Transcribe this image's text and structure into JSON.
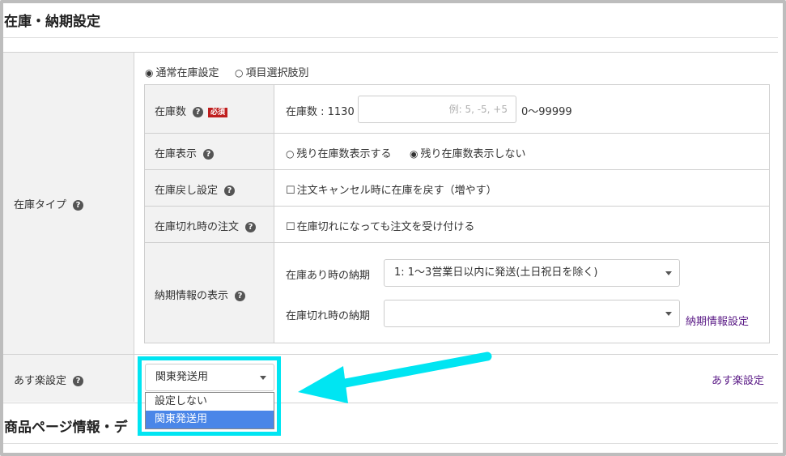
{
  "section1": {
    "title": "在庫・納期設定"
  },
  "section2": {
    "title": "商品ページ情報・デ"
  },
  "stock_type": {
    "label": "在庫タイプ",
    "options": [
      "通常在庫設定",
      "項目選択肢別"
    ],
    "selected": "通常在庫設定"
  },
  "rows": {
    "stock_qty": {
      "label": "在庫数",
      "required": "必須",
      "current": "在庫数 : 1130",
      "placeholder": "例: 5, -5, +5",
      "range": "0〜99999"
    },
    "stock_display": {
      "label": "在庫表示",
      "option_a": "残り在庫数表示する",
      "option_b": "残り在庫数表示しない"
    },
    "stock_return": {
      "label": "在庫戻し設定",
      "checkbox": "注文キャンセル時に在庫を戻す（増やす）"
    },
    "out_of_stock": {
      "label": "在庫切れ時の注文",
      "checkbox": "在庫切れになっても注文を受け付ける"
    },
    "delivery": {
      "label": "納期情報の表示",
      "in_stock_label": "在庫あり時の納期",
      "in_stock_value": "1: 1〜3営業日以内に発送(土日祝日を除く)",
      "out_stock_label": "在庫切れ時の納期",
      "out_stock_value": "",
      "link": "納期情報設定"
    }
  },
  "asuraku": {
    "label": "あす楽設定",
    "selected": "関東発送用",
    "options": [
      "設定しない",
      "関東発送用"
    ],
    "link": "あす楽設定"
  },
  "icons": {
    "help": "?",
    "radio_on": "◉",
    "radio_off": "○",
    "checkbox": "☐"
  },
  "colors": {
    "highlight": "#00e5f2",
    "link": "#5a1a86",
    "required_badge": "#bf1e1e",
    "selected_option": "#4a86e8"
  }
}
